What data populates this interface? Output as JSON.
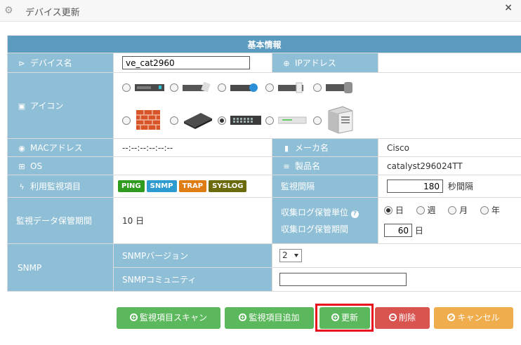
{
  "window": {
    "title": "デバイス更新"
  },
  "section_header": "基本情報",
  "fields": {
    "device_name": {
      "label": "デバイス名",
      "value": "ve_cat2960"
    },
    "ip_address": {
      "label": "IPアドレス",
      "value": ""
    },
    "icon": {
      "label": "アイコン",
      "selected_index": 7
    },
    "mac_address": {
      "label": "MACアドレス",
      "value": "--:--:--:--:--:--"
    },
    "maker": {
      "label": "メーカ名",
      "value": "Cisco"
    },
    "os": {
      "label": "OS",
      "value": ""
    },
    "product": {
      "label": "製品名",
      "value": "catalyst296024TT"
    },
    "monitor_items": {
      "label": "利用監視項目"
    },
    "monitor_interval": {
      "label": "監視間隔",
      "value": "180",
      "unit": "秒間隔"
    },
    "retention": {
      "label": "監視データ保管期間",
      "value": "10 日"
    },
    "log_unit": {
      "label": "収集ログ保管単位",
      "options": [
        "日",
        "週",
        "月",
        "年"
      ],
      "selected": "日"
    },
    "log_period": {
      "label": "収集ログ保管期間",
      "value": "60",
      "unit": "日"
    },
    "snmp": {
      "label": "SNMP",
      "version_label": "SNMPバージョン",
      "version_value": "2",
      "community_label": "SNMPコミュニティ",
      "community_value": ""
    }
  },
  "badges": [
    {
      "text": "PING",
      "color": "#2f9b1f"
    },
    {
      "text": "SNMP",
      "color": "#2e9bd0"
    },
    {
      "text": "TRAP",
      "color": "#e07c14"
    },
    {
      "text": "SYSLOG",
      "color": "#6b6b0c"
    }
  ],
  "buttons": {
    "scan": "監視項目スキャン",
    "add": "監視項目追加",
    "update": "更新",
    "delete": "削除",
    "cancel": "キャンセル"
  },
  "colors": {
    "header": "#5b9bbf",
    "label": "#8fbfd6",
    "green_button": "#5cb85c",
    "red_button": "#d9534f",
    "orange_button": "#f0ad4e",
    "focus": "#e8101a"
  }
}
